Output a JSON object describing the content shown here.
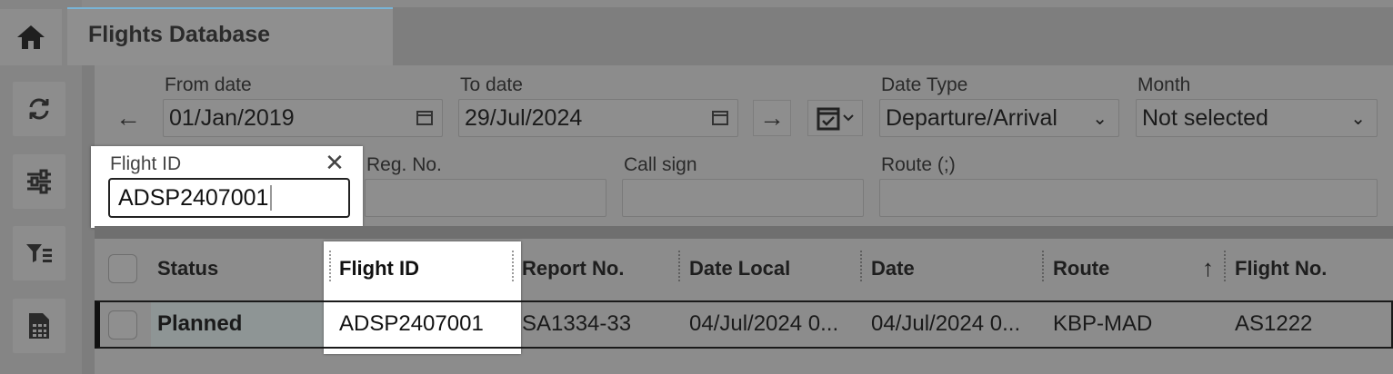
{
  "rail": {
    "icons": [
      "home-icon",
      "refresh-icon",
      "sliders-icon",
      "filter-list-icon",
      "spreadsheet-icon"
    ]
  },
  "tab": {
    "title": "Flights Database"
  },
  "filters": {
    "from_date": {
      "label": "From date",
      "value": "01/Jan/2019"
    },
    "to_date": {
      "label": "To date",
      "value": "29/Jul/2024"
    },
    "date_type": {
      "label": "Date Type",
      "value": "Departure/Arrival"
    },
    "month": {
      "label": "Month",
      "value": "Not selected"
    },
    "flight_id": {
      "label": "Flight ID",
      "value": "ADSP2407001"
    },
    "reg_no": {
      "label": "Reg. No.",
      "value": ""
    },
    "call_sign": {
      "label": "Call sign",
      "value": ""
    },
    "route": {
      "label": "Route (;)",
      "value": ""
    }
  },
  "grid": {
    "columns": [
      "Status",
      "Flight ID",
      "Report No.",
      "Date Local",
      "Date",
      "Route",
      "Flight No."
    ],
    "sort_indicator": "↑",
    "rows": [
      {
        "status": "Planned",
        "flight_id": "ADSP2407001",
        "report_no": "SA1334-33",
        "date_local": "04/Jul/2024 0...",
        "date": "04/Jul/2024 0...",
        "route": "KBP-MAD",
        "flight_no": "AS1222"
      }
    ]
  }
}
